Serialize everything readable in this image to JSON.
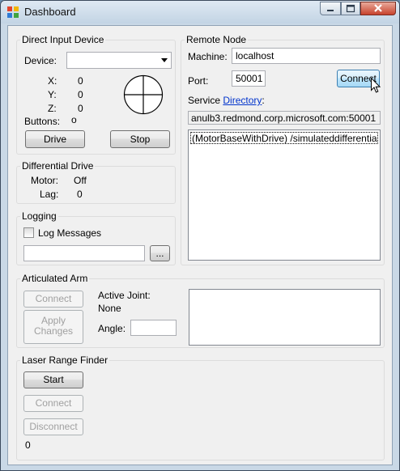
{
  "window": {
    "title": "Dashboard"
  },
  "direct_input": {
    "group_label": "Direct Input Device",
    "device_label": "Device:",
    "device_value": "",
    "x_label": "X:",
    "x_value": "0",
    "y_label": "Y:",
    "y_value": "0",
    "z_label": "Z:",
    "z_value": "0",
    "buttons_label": "Buttons:",
    "buttons_value": "o",
    "drive_label": "Drive",
    "stop_label": "Stop"
  },
  "remote_node": {
    "group_label": "Remote Node",
    "machine_label": "Machine:",
    "machine_value": "localhost",
    "port_label": "Port:",
    "port_value": "50001",
    "connect_label": "Connect",
    "service_label": "Service",
    "directory_link": "Directory",
    "directory_colon": ":",
    "service_address": "anulb3.redmond.corp.microsoft.com:50001",
    "services": [
      "(MotorBaseWithDrive) /simulateddifferentialdrive/"
    ]
  },
  "differential_drive": {
    "group_label": "Differential Drive",
    "motor_label": "Motor:",
    "motor_value": "Off",
    "lag_label": "Lag:",
    "lag_value": "0"
  },
  "logging": {
    "group_label": "Logging",
    "log_messages_label": "Log Messages",
    "log_messages_checked": false,
    "log_file_value": "",
    "browse_label": "..."
  },
  "articulated_arm": {
    "group_label": "Articulated Arm",
    "connect_label": "Connect",
    "apply_changes_line1": "Apply",
    "apply_changes_line2": "Changes",
    "active_joint_label": "Active Joint:",
    "active_joint_value": "None",
    "angle_label": "Angle:",
    "angle_value": ""
  },
  "laser_range_finder": {
    "group_label": "Laser Range Finder",
    "start_label": "Start",
    "connect_label": "Connect",
    "disconnect_label": "Disconnect",
    "status_value": "0"
  },
  "icons": {
    "app_icon": "dashboard-app-icon",
    "combo_arrow": "chevron-down-icon",
    "joystick": "joystick-crosshair-icon",
    "cursor": "mouse-pointer-icon"
  }
}
